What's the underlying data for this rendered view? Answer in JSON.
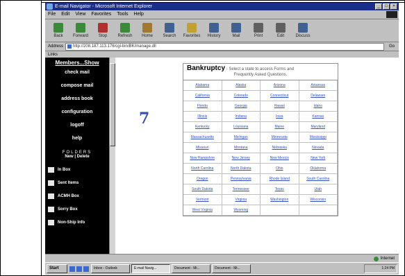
{
  "window": {
    "title": "E-mail Navigator - Microsoft Internet Explorer",
    "controls": [
      "_",
      "□",
      "×"
    ]
  },
  "menubar": [
    "File",
    "Edit",
    "View",
    "Favorites",
    "Tools",
    "Help"
  ],
  "toolbar": [
    {
      "label": "Back",
      "icon": "back-arrow-icon",
      "color": "#3a8a3a"
    },
    {
      "label": "Forward",
      "icon": "forward-arrow-icon",
      "color": "#3a8a3a"
    },
    {
      "label": "Stop",
      "icon": "stop-icon",
      "color": "#b03030"
    },
    {
      "label": "Refresh",
      "icon": "refresh-icon",
      "color": "#3a8a3a"
    },
    {
      "label": "Home",
      "icon": "home-icon",
      "color": "#a07830"
    },
    {
      "label": "Search",
      "icon": "search-icon",
      "color": "#406090"
    },
    {
      "label": "Favorites",
      "icon": "favorites-icon",
      "color": "#c0a030"
    },
    {
      "label": "History",
      "icon": "history-icon",
      "color": "#406090"
    },
    {
      "label": "Mail",
      "icon": "mail-icon",
      "color": "#406090"
    },
    {
      "label": "Print",
      "icon": "print-icon",
      "color": "#606060"
    },
    {
      "label": "Edit",
      "icon": "edit-icon",
      "color": "#606060"
    },
    {
      "label": "Discuss",
      "icon": "discuss-icon",
      "color": "#406090"
    }
  ],
  "address": {
    "label": "Address",
    "value": "http://208.187.113.176/cgi-bin/BK/manage.dll",
    "go_label": "Go",
    "links_label": "Links"
  },
  "leftnav": {
    "heading": "Members...Show",
    "items": [
      "check mail",
      "compose mail",
      "address book",
      "configuration",
      "logoff",
      "help"
    ],
    "folders_title": "FOLDERS",
    "folders_sub": "New | Delete",
    "folders": [
      "In Box",
      "Sent Items",
      "ACMH Box",
      "Sorry Box",
      "Non-Ship Info"
    ]
  },
  "main": {
    "big_number": "7",
    "bankruptcy": {
      "title": "Bankruptcy",
      "description": " - Select a state to access Forms and",
      "description2": "Frequently Asked Questions.",
      "states": [
        "Alabama",
        "Alaska",
        "Arizona",
        "Arkansas",
        "California",
        "Colorado",
        "Connecticut",
        "Delaware",
        "Florida",
        "Georgia",
        "Hawaii",
        "Idaho",
        "Illinois",
        "Indiana",
        "Iowa",
        "Kansas",
        "Kentucky",
        "Louisiana",
        "Maine",
        "Maryland",
        "Massachusetts",
        "Michigan",
        "Minnesota",
        "Mississippi",
        "Missouri",
        "Montana",
        "Nebraska",
        "Nevada",
        "New Hampshire",
        "New Jersey",
        "New Mexico",
        "New York",
        "North Carolina",
        "North Dakota",
        "Ohio",
        "Oklahoma",
        "Oregon",
        "Pennsylvania",
        "Rhode Island",
        "South Carolina",
        "South Dakota",
        "Tennessee",
        "Texas",
        "Utah",
        "Vermont",
        "Virginia",
        "Washington",
        "Wisconsin",
        "West Virginia",
        "Wyoming",
        "",
        ""
      ]
    }
  },
  "status": {
    "text": "",
    "zone": "Internet"
  },
  "taskbar": {
    "start": "Start",
    "tasks": [
      "Inbox - Outlook",
      "E-mail Navig...",
      "Document - Mi...",
      "Document - Mi..."
    ],
    "clock": "1:24 PM"
  }
}
